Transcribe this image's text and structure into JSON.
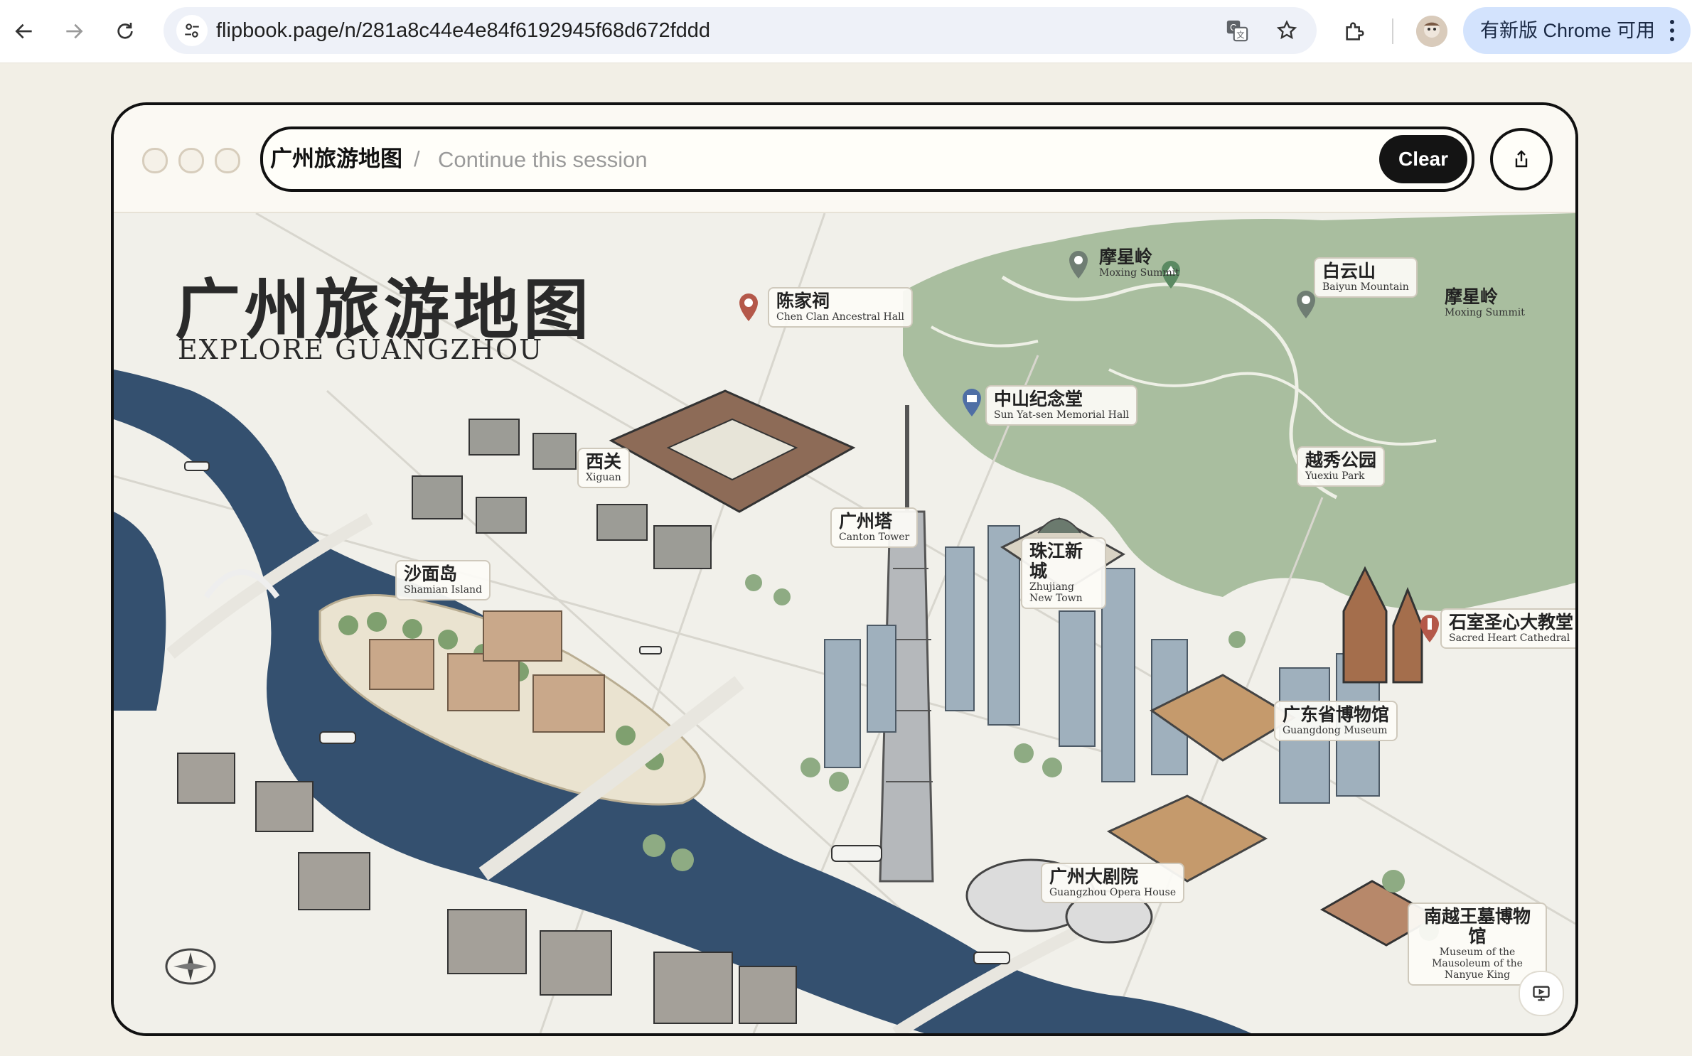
{
  "browser": {
    "url": "flipbook.page/n/281a8c44e4e84f6192945f68d672fddd",
    "update_label": "有新版 Chrome 可用",
    "icons": {
      "back": "arrow-left-icon",
      "forward": "arrow-right-icon",
      "reload": "reload-icon",
      "site_info": "tune-icon",
      "translate": "translate-icon",
      "bookmark": "star-icon",
      "extensions": "puzzle-icon",
      "menu": "kebab-icon"
    }
  },
  "session": {
    "title": "广州旅游地图",
    "separator": "/",
    "placeholder": "Continue this session",
    "clear_label": "Clear"
  },
  "map": {
    "title_zh": "广州旅游地图",
    "title_en": "EXPLORE GUANGZHOU",
    "labels": [
      {
        "zh": "陈家祠",
        "en": "Chen Clan Ancestral Hall"
      },
      {
        "zh": "摩星岭",
        "en": "Moxing Summit"
      },
      {
        "zh": "白云山",
        "en": "Baiyun Mountain"
      },
      {
        "zh": "摩星岭",
        "en": "Moxing Summit"
      },
      {
        "zh": "中山纪念堂",
        "en": "Sun Yat-sen Memorial Hall"
      },
      {
        "zh": "西关",
        "en": "Xiguan"
      },
      {
        "zh": "越秀公园",
        "en": "Yuexiu Park"
      },
      {
        "zh": "广州塔",
        "en": "Canton Tower"
      },
      {
        "zh": "珠江新城",
        "en": "Zhujiang New Town"
      },
      {
        "zh": "沙面岛",
        "en": "Shamian Island"
      },
      {
        "zh": "石室圣心大教堂",
        "en": "Sacred Heart Cathedral"
      },
      {
        "zh": "广东省博物馆",
        "en": "Guangdong Museum"
      },
      {
        "zh": "广州大剧院",
        "en": "Guangzhou Opera House"
      },
      {
        "zh": "南越王墓博物馆",
        "en": "Museum of the Mausoleum of the Nanyue King"
      }
    ]
  },
  "colors": {
    "river": "#2f4a6b",
    "hills": "#8fac86",
    "parchment": "#f1f0ea",
    "pin_red": "#b4584a",
    "pin_blue": "#4f6fa5"
  }
}
